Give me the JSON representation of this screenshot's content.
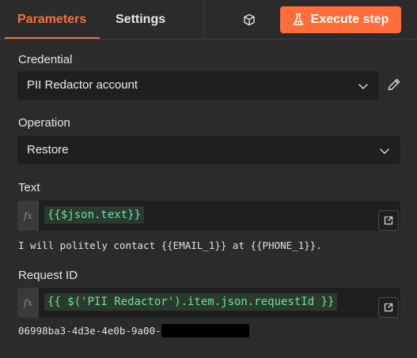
{
  "tabs": {
    "parameters": "Parameters",
    "settings": "Settings"
  },
  "actions": {
    "execute_label": "Execute step",
    "accent_color": "#ff6d3a",
    "cube_icon": "cube-icon",
    "flask_icon": "flask-icon"
  },
  "credential": {
    "label": "Credential",
    "value": "PII Redactor account",
    "edit_icon": "pencil-icon"
  },
  "operation": {
    "label": "Operation",
    "value": "Restore"
  },
  "text_field": {
    "label": "Text",
    "fx": "fx",
    "expression": "{{$json.text}}",
    "result": "I will politely contact {{EMAIL_1}} at {{PHONE_1}}."
  },
  "request_id": {
    "label": "Request ID",
    "fx": "fx",
    "expression": "{{ $('PII Redactor').item.json.requestId }}",
    "result": "06998ba3-4d3e-4e0b-9a00-"
  }
}
